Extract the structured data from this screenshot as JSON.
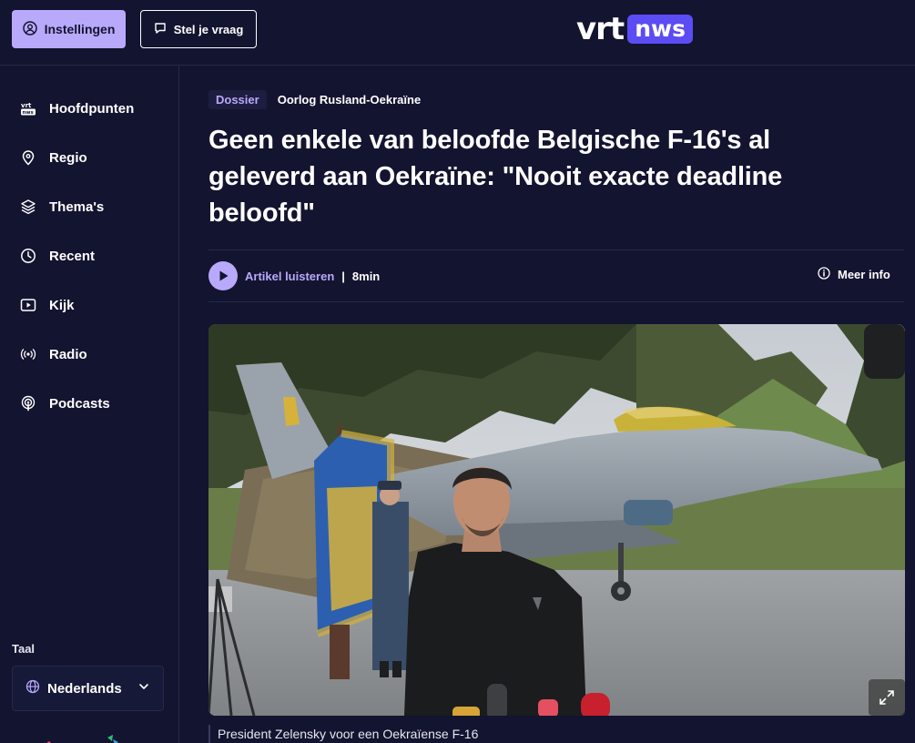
{
  "header": {
    "settings_label": "Instellingen",
    "ask_label": "Stel je vraag",
    "logo_left": "vrt",
    "logo_right": "nws"
  },
  "sidebar": {
    "items": [
      {
        "label": "Hoofdpunten",
        "icon": "vrt-nws-icon"
      },
      {
        "label": "Regio",
        "icon": "location-pin-icon"
      },
      {
        "label": "Thema's",
        "icon": "layers-icon"
      },
      {
        "label": "Recent",
        "icon": "clock-icon"
      },
      {
        "label": "Kijk",
        "icon": "play-box-icon"
      },
      {
        "label": "Radio",
        "icon": "broadcast-icon"
      },
      {
        "label": "Podcasts",
        "icon": "podcast-icon"
      }
    ],
    "language_heading": "Taal",
    "language_value": "Nederlands"
  },
  "article": {
    "dossier_label": "Dossier",
    "dossier_topic": "Oorlog Rusland-Oekraïne",
    "title": "Geen enkele van beloofde Belgische F-16's al geleverd aan Oekraïne: \"Nooit exacte deadline beloofd\"",
    "listen_label": "Artikel luisteren",
    "separator": "|",
    "duration": "8min",
    "more_info": "Meer info",
    "caption": "President Zelensky voor een Oekraïense F-16"
  },
  "colors": {
    "background": "#131430",
    "accent": "#b9a9fb",
    "brand": "#5b4cf3"
  }
}
